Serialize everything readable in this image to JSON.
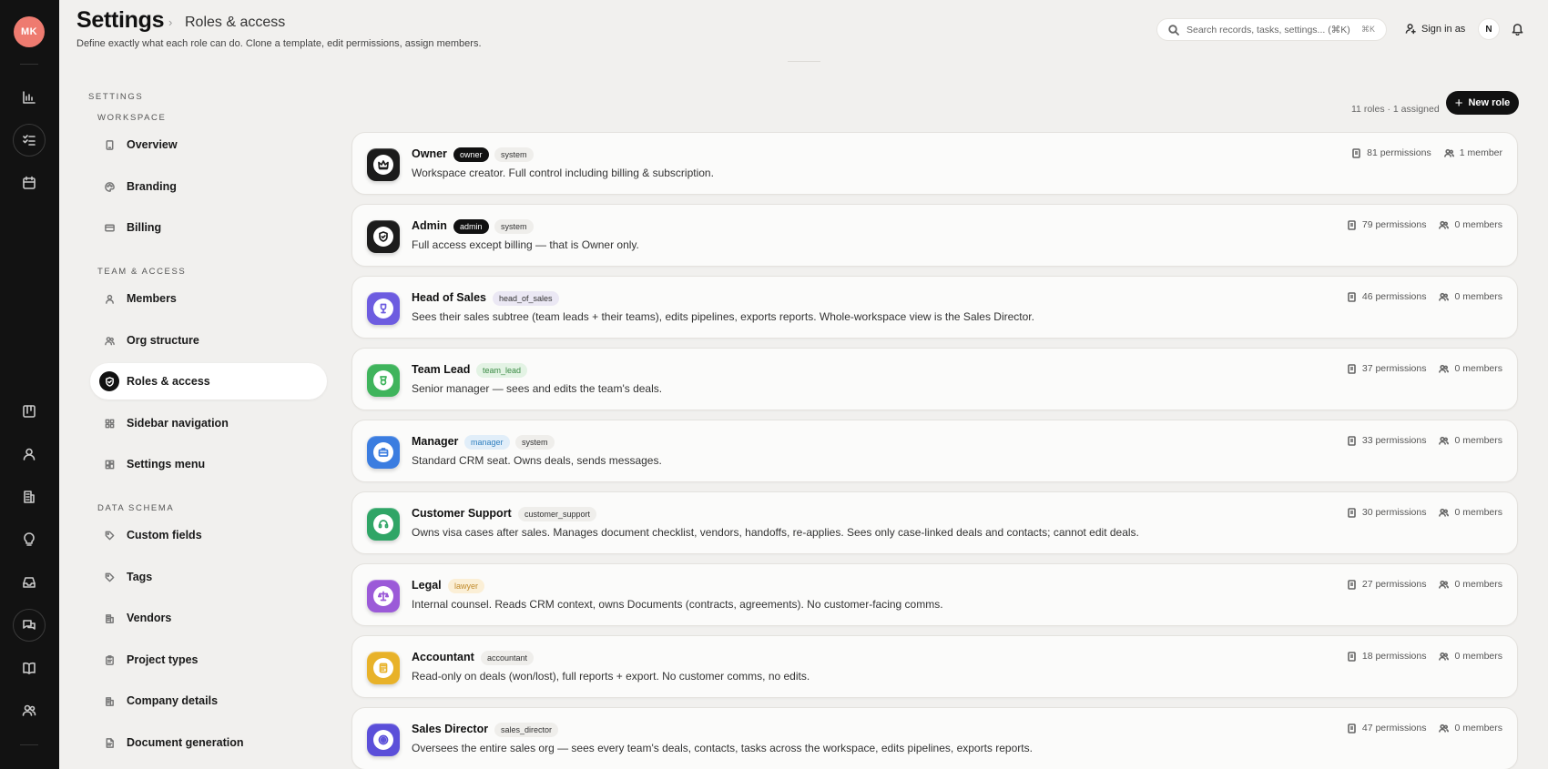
{
  "user": {
    "initials": "MK",
    "switch_initial": "N"
  },
  "header": {
    "title": "Settings",
    "breadcrumb": "Roles & access",
    "subtitle": "Define exactly what each role can do. Clone a template, edit permissions, assign members.",
    "search_placeholder": "Search records, tasks, settings... (⌘K)",
    "search_shortcut": "⌘K",
    "sign_in_as": "Sign in as"
  },
  "nav": {
    "caption": "SETTINGS",
    "sections": [
      {
        "title": "WORKSPACE",
        "items": [
          "Overview",
          "Branding",
          "Billing"
        ]
      },
      {
        "title": "TEAM & ACCESS",
        "items": [
          "Members",
          "Org structure",
          "Roles & access",
          "Sidebar navigation",
          "Settings menu"
        ]
      },
      {
        "title": "DATA SCHEMA",
        "items": [
          "Custom fields",
          "Tags",
          "Vendors",
          "Project types",
          "Company details",
          "Document generation"
        ]
      }
    ],
    "active": "Roles & access"
  },
  "content": {
    "summary": "11 roles · 1 assigned",
    "new_role_label": "New role"
  },
  "roles": [
    {
      "name": "Owner",
      "tags": [
        {
          "text": "owner",
          "style": "dark"
        },
        {
          "text": "system",
          "style": "grey"
        }
      ],
      "description": "Workspace creator. Full control including billing & subscription.",
      "permissions": "81 permissions",
      "members": "1 member",
      "icon": "crown-icon",
      "color": "#1c1c1c"
    },
    {
      "name": "Admin",
      "tags": [
        {
          "text": "admin",
          "style": "dark"
        },
        {
          "text": "system",
          "style": "grey"
        }
      ],
      "description": "Full access except billing — that is Owner only.",
      "permissions": "79 permissions",
      "members": "0 members",
      "icon": "shield-icon",
      "color": "#1c1c1c"
    },
    {
      "name": "Head of Sales",
      "tags": [
        {
          "text": "head_of_sales",
          "style": "lav"
        }
      ],
      "description": "Sees their sales subtree (team leads + their teams), edits pipelines, exports reports. Whole-workspace view is the Sales Director.",
      "permissions": "46 permissions",
      "members": "0 members",
      "icon": "trophy-icon",
      "color": "#6d5ce0"
    },
    {
      "name": "Team Lead",
      "tags": [
        {
          "text": "team_lead",
          "style": "green"
        }
      ],
      "description": "Senior manager — sees and edits the team's deals.",
      "permissions": "37 permissions",
      "members": "0 members",
      "icon": "badge-icon",
      "color": "#3fb45c"
    },
    {
      "name": "Manager",
      "tags": [
        {
          "text": "manager",
          "style": "blue"
        },
        {
          "text": "system",
          "style": "grey"
        }
      ],
      "description": "Standard CRM seat. Owns deals, sends messages.",
      "permissions": "33 permissions",
      "members": "0 members",
      "icon": "briefcase-icon",
      "color": "#3b7de0"
    },
    {
      "name": "Customer Support",
      "tags": [
        {
          "text": "customer_support",
          "style": "grey"
        }
      ],
      "description": "Owns visa cases after sales. Manages document checklist, vendors, handoffs, re-applies. Sees only case-linked deals and contacts; cannot edit deals.",
      "permissions": "30 permissions",
      "members": "0 members",
      "icon": "headset-icon",
      "color": "#2fa566"
    },
    {
      "name": "Legal",
      "tags": [
        {
          "text": "lawyer",
          "style": "amber"
        }
      ],
      "description": "Internal counsel. Reads CRM context, owns Documents (contracts, agreements). No customer-facing comms.",
      "permissions": "27 permissions",
      "members": "0 members",
      "icon": "scale-icon",
      "color": "#9b5ad8"
    },
    {
      "name": "Accountant",
      "tags": [
        {
          "text": "accountant",
          "style": "grey"
        }
      ],
      "description": "Read-only on deals (won/lost), full reports + export. No customer comms, no edits.",
      "permissions": "18 permissions",
      "members": "0 members",
      "icon": "calculator-icon",
      "color": "#e8b229"
    },
    {
      "name": "Sales Director",
      "tags": [
        {
          "text": "sales_director",
          "style": "grey"
        }
      ],
      "description": "Oversees the entire sales org — sees every team's deals, contacts, tasks across the workspace, edits pipelines, exports reports.",
      "permissions": "47 permissions",
      "members": "0 members",
      "icon": "target-icon",
      "color": "#5b4fd9"
    }
  ]
}
